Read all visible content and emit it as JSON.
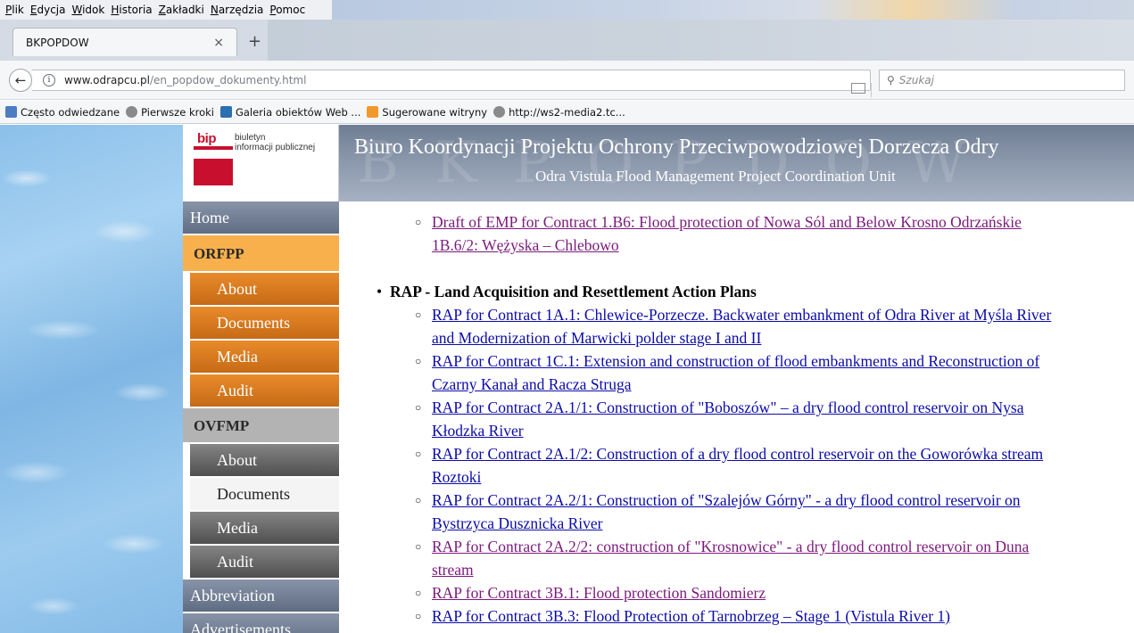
{
  "browser": {
    "menu": [
      "Plik",
      "Edycja",
      "Widok",
      "Historia",
      "Zakładki",
      "Narzędzia",
      "Pomoc"
    ],
    "tab": {
      "title": "BKPOPDOW",
      "close": "×",
      "new_tab": "+"
    },
    "url": {
      "host": "www.odrapcu.pl",
      "path": "/en_popdow_dokumenty.html"
    },
    "search_placeholder": "Szukaj",
    "bookmarks": [
      {
        "label": "Często odwiedzane",
        "icon": "blue"
      },
      {
        "label": "Pierwsze kroki",
        "icon": "globe"
      },
      {
        "label": "Galeria obiektów Web ...",
        "icon": "galeria"
      },
      {
        "label": "Sugerowane witryny",
        "icon": "orange"
      },
      {
        "label": "http://ws2-media2.tc...",
        "icon": "globe"
      }
    ]
  },
  "logo": {
    "mark": "bip",
    "caption_line1": "biuletyn",
    "caption_line2": "informacji publicznej"
  },
  "header": {
    "watermark": "BKPOPDOW",
    "title": "Biuro Koordynacji Projektu Ochrony Przeciwpowodziowej Dorzecza Odry",
    "subtitle": "Odra Vistula Flood Management Project Coordination Unit"
  },
  "nav": {
    "home": "Home",
    "orfpp": "ORFPP",
    "orfpp_items": [
      "About",
      "Documents",
      "Media",
      "Audit"
    ],
    "ovfmp": "OVFMP",
    "ovfmp_items": [
      "About",
      "Documents",
      "Media",
      "Audit"
    ],
    "abbreviation": "Abbreviation",
    "advertisements": "Advertisements"
  },
  "content": {
    "emp_item": {
      "line1": "Draft of EMP for Contract 1.B6: Flood protection of Nowa Sól and Below Krosno Odrzańskie",
      "line2": "1B.6/2: Wężyska – Chlebowo"
    },
    "rap_heading_bold": "RAP",
    "rap_heading_rest": " - Land Acquisition and Resettlement Action Plans",
    "rap_items": [
      {
        "line1": "RAP for Contract 1A.1: Chlewice-Porzecze. Backwater embankment of Odra River at Myśla River",
        "line2": "and Modernization of Marwicki polder stage I and II",
        "visited": false
      },
      {
        "line1": "RAP for Contract 1C.1: Extension and construction of flood embankments and Reconstruction of",
        "line2": "Czarny Kanał and Racza Struga",
        "visited": false
      },
      {
        "line1": "RAP for Contract 2A.1/1: Construction of \"Boboszów\" – a dry flood control reservoir on Nysa",
        "line2": "Kłodzka River",
        "visited": false
      },
      {
        "line1": "RAP for Contract 2A.1/2: Construction of a dry flood control reservoir on the Goworówka stream",
        "line2": "Roztoki",
        "visited": false
      },
      {
        "line1": "RAP for Contract 2A.2/1: Construction of \"Szalejów Górny\" - a dry flood control reservoir on",
        "line2": "Bystrzyca Dusznicka River",
        "visited": false
      },
      {
        "line1": "RAP for Contract 2A.2/2: construction of \"Krosnowice\" - a dry flood control reservoir on Duna",
        "line2": "stream",
        "visited": true
      },
      {
        "line1": "RAP for Contract 3B.1: Flood protection Sandomierz",
        "line2": "",
        "visited": true
      },
      {
        "line1": "RAP for Contract 3B.3: Flood Protection of Tarnobrzeg – Stage 1 (Vistula River 1)",
        "line2": "",
        "visited": false
      }
    ]
  }
}
